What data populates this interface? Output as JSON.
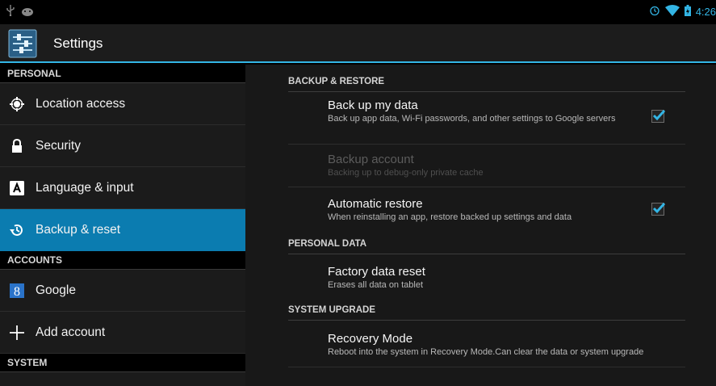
{
  "status": {
    "time": "4:26",
    "icons": [
      "usb-icon",
      "debug-android-icon",
      "alarm-icon",
      "wifi-icon",
      "battery-icon"
    ]
  },
  "header": {
    "title": "Settings"
  },
  "sidebar": {
    "sections": [
      {
        "label": "PERSONAL"
      },
      {
        "label": "ACCOUNTS"
      },
      {
        "label": "SYSTEM"
      }
    ],
    "items": [
      {
        "label": "Location access",
        "icon": "location-icon"
      },
      {
        "label": "Security",
        "icon": "lock-icon"
      },
      {
        "label": "Language & input",
        "icon": "keyboard-icon"
      },
      {
        "label": "Backup & reset",
        "icon": "backup-icon",
        "active": true
      },
      {
        "label": "Google",
        "icon": "google-icon"
      },
      {
        "label": "Add account",
        "icon": "plus-icon"
      }
    ]
  },
  "main": {
    "categories": [
      {
        "label": "BACKUP & RESTORE"
      },
      {
        "label": "PERSONAL DATA"
      },
      {
        "label": "SYSTEM UPGRADE"
      }
    ],
    "prefs": [
      {
        "title": "Back up my data",
        "summary": "Back up app data, Wi-Fi passwords, and other settings to Google servers",
        "checked": true
      },
      {
        "title": "Backup account",
        "summary": "Backing up to debug-only private cache",
        "enabled": false
      },
      {
        "title": "Automatic restore",
        "summary": "When reinstalling an app, restore backed up settings and data",
        "checked": true
      },
      {
        "title": "Factory data reset",
        "summary": "Erases all data on tablet"
      },
      {
        "title": "Recovery Mode",
        "summary": "Reboot into the system in Recovery Mode.Can clear the data or system upgrade"
      }
    ]
  },
  "colors": {
    "accent": "#33b5e5",
    "selected": "#0b7cb0"
  }
}
